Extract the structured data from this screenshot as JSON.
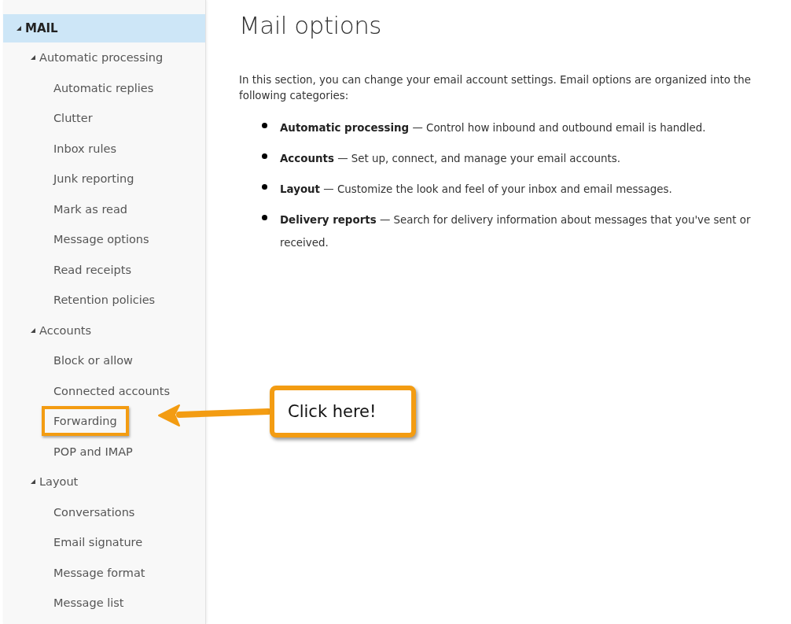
{
  "sidebar": {
    "items": [
      {
        "label": "MAIL",
        "selected": true,
        "expanded": true,
        "children": [
          {
            "label": "Automatic processing",
            "selected": false,
            "expanded": true,
            "children": [
              {
                "label": "Automatic replies",
                "selected": false,
                "highlighted": false
              },
              {
                "label": "Clutter",
                "selected": false,
                "highlighted": false
              },
              {
                "label": "Inbox rules",
                "selected": false,
                "highlighted": false
              },
              {
                "label": "Junk reporting",
                "selected": false,
                "highlighted": false
              },
              {
                "label": "Mark as read",
                "selected": false,
                "highlighted": false
              },
              {
                "label": "Message options",
                "selected": false,
                "highlighted": false
              },
              {
                "label": "Read receipts",
                "selected": false,
                "highlighted": false
              },
              {
                "label": "Retention policies",
                "selected": false,
                "highlighted": false
              }
            ]
          },
          {
            "label": "Accounts",
            "selected": false,
            "expanded": true,
            "children": [
              {
                "label": "Block or allow",
                "selected": false,
                "highlighted": false
              },
              {
                "label": "Connected accounts",
                "selected": false,
                "highlighted": false
              },
              {
                "label": "Forwarding",
                "selected": false,
                "highlighted": true
              },
              {
                "label": "POP and IMAP",
                "selected": false,
                "highlighted": false
              }
            ]
          },
          {
            "label": "Layout",
            "selected": false,
            "expanded": true,
            "children": [
              {
                "label": "Conversations",
                "selected": false,
                "highlighted": false
              },
              {
                "label": "Email signature",
                "selected": false,
                "highlighted": false
              },
              {
                "label": "Message format",
                "selected": false,
                "highlighted": false
              },
              {
                "label": "Message list",
                "selected": false,
                "highlighted": false
              }
            ]
          }
        ]
      }
    ]
  },
  "main": {
    "title": "Mail options",
    "intro": "In this section, you can change your email account settings. Email options are organized into the following categories:",
    "bullets": [
      "**Automatic processing** — Control how inbound and outbound email is handled.",
      "**Accounts** — Set up, connect, and manage your email accounts.",
      "**Layout** — Customize the look and feel of your inbox and email messages.",
      "**Delivery reports** — Search for delivery information about messages that you've sent or received."
    ]
  },
  "callout": {
    "text": "Click here!"
  }
}
